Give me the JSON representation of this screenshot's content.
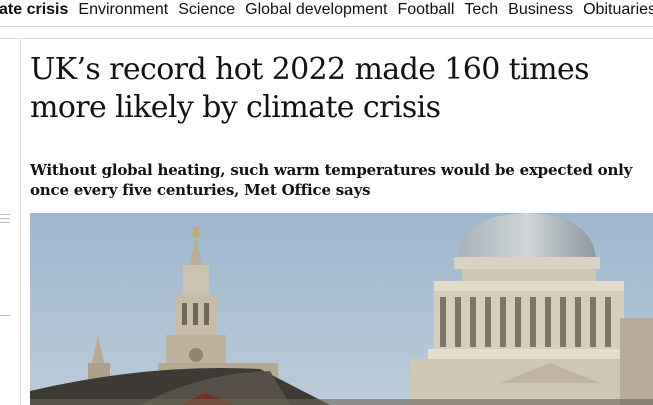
{
  "nav": {
    "items": [
      {
        "label": "ate crisis",
        "active": true
      },
      {
        "label": "Environment",
        "active": false
      },
      {
        "label": "Science",
        "active": false
      },
      {
        "label": "Global development",
        "active": false
      },
      {
        "label": "Football",
        "active": false
      },
      {
        "label": "Tech",
        "active": false
      },
      {
        "label": "Business",
        "active": false
      },
      {
        "label": "Obituaries",
        "active": false
      }
    ]
  },
  "article": {
    "headline": "UK’s record hot 2022 made 160 times more likely by climate crisis",
    "standfirst": "Without global heating, such warm temperatures would be expected only once every five centuries, Met Office says"
  },
  "hero_image": {
    "icon": "cathedral-photo",
    "colors": {
      "sky": "#a9bfd6",
      "stone": "#d6cfc2",
      "shadow": "#8e8778",
      "dark": "#2a2a2a"
    }
  }
}
